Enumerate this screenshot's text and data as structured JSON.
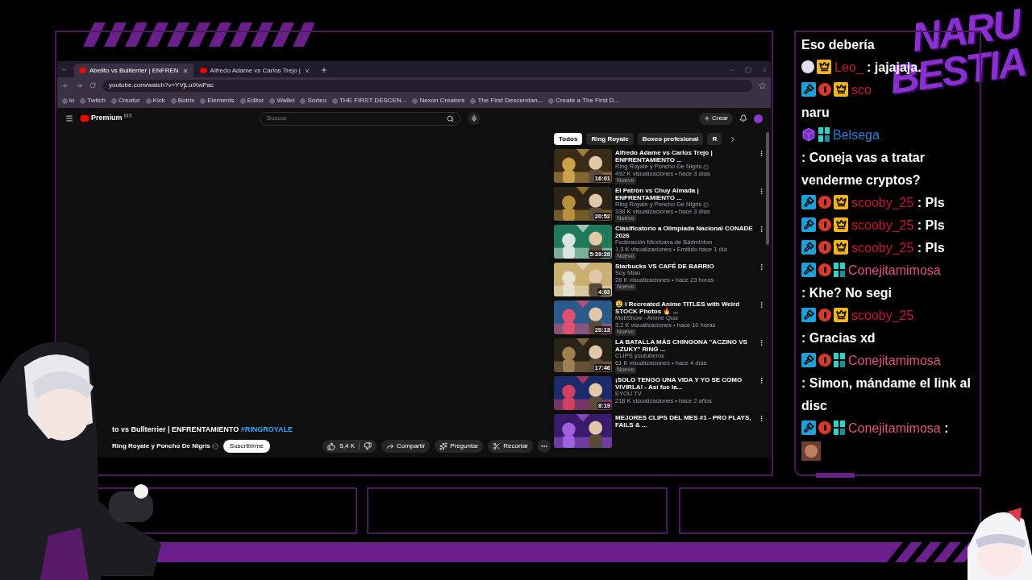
{
  "browser": {
    "tabs": [
      {
        "title": "Abelito vs Bullterrier | ENFREN",
        "selected": true
      },
      {
        "title": "Alfredo Adame vs Carlos Trejo |",
        "selected": false
      }
    ],
    "url": "youtube.com/watch?v=YVjLuiXwPac",
    "bookmarks": [
      {
        "label": "io"
      },
      {
        "label": "Twitch"
      },
      {
        "label": "Creator"
      },
      {
        "label": "Kick"
      },
      {
        "label": "Botrix"
      },
      {
        "label": "Elements"
      },
      {
        "label": "Editor"
      },
      {
        "label": "Wallet"
      },
      {
        "label": "Sorteo"
      },
      {
        "label": "THE FIRST DESCEN..."
      },
      {
        "label": "Nexon Creators"
      },
      {
        "label": "The First Descendan..."
      },
      {
        "label": "Create a The First D..."
      }
    ]
  },
  "youtube": {
    "logo": "Premium",
    "region": "MX",
    "search_placeholder": "Buscar",
    "create": "Crear",
    "video": {
      "title": "to vs Bullterrier | ENFRENTAMIENTO",
      "hashtag": "#RINGROYALE",
      "channel": "Ring Royale y Poncho De Nigris",
      "subscribe": "Suscribirme",
      "likes": "5,4 K",
      "actions": [
        {
          "kind": "share",
          "label": "Compartir"
        },
        {
          "kind": "ask",
          "label": "Preguntar"
        },
        {
          "kind": "clip",
          "label": "Recortar"
        }
      ]
    },
    "chips": [
      {
        "label": "Todos",
        "selected": true
      },
      {
        "label": "Ring Royale",
        "selected": false
      },
      {
        "label": "Boxeo profesional",
        "selected": false
      },
      {
        "label": "R",
        "selected": false
      }
    ],
    "related": [
      {
        "title": "Alfredo Adame vs Carlos Trejo | ENFRENTAMIENTO ...",
        "channel": "Ring Royale y Poncho De Nigris",
        "verified": true,
        "stats": "492 K visualizaciones • hace 3 días",
        "badge": "Nuevo",
        "duration": "16:01"
      },
      {
        "title": "El Patrón vs Chuy Almada | ENFRENTAMIENTO ...",
        "channel": "Ring Royale y Poncho De Nigris",
        "verified": true,
        "stats": "338 K visualizaciones • hace 3 días",
        "badge": "Nuevo",
        "duration": "20:52"
      },
      {
        "title": "Clasificatorio a Olimpiada Nacional CONADE 2026",
        "channel": "Federación Mexicana de Bádminton",
        "verified": false,
        "stats": "1,3 K visualizaciones • Emitido hace 1 día",
        "badge": "Nuevo",
        "duration": "5:39:28"
      },
      {
        "title": "Starbucks VS CAFÉ DE BARRIO",
        "channel": "Soy Miau",
        "verified": false,
        "stats": "28 K visualizaciones • hace 23 horas",
        "badge": "Nuevo",
        "duration": "4:02"
      },
      {
        "title": "😩 I Recreated Anime TITLES with Weird STOCK Photos 🔥 ...",
        "channel": "MobShow - Anime Quiz",
        "verified": false,
        "stats": "3,2 K visualizaciones • hace 10 horas",
        "badge": "Nuevo",
        "duration": "20:13"
      },
      {
        "title": "LA BATALLA MÁS CHINGONA \"ACZINO VS AZUKY\" RING ...",
        "channel": "CLIPS youtuberos",
        "verified": false,
        "stats": "61 K visualizaciones • hace 4 días",
        "badge": "Nuevo",
        "duration": "17:46"
      },
      {
        "title": "¡SOLO TENGO UNA VIDA Y YO SE COMO VIVIRLA! - Así fue la...",
        "channel": "EYOU TV",
        "verified": false,
        "stats": "218 K visualizaciones • hace 2 años",
        "duration": "8:19"
      },
      {
        "title": "MEJORES CLIPS DEL MES #1 - PRO PLAYS, FAILS & ..."
      }
    ]
  },
  "chat": [
    {
      "kind": "text",
      "text": "Eso debería"
    },
    {
      "kind": "message",
      "badges": [
        {
          "kind": "dot"
        },
        {
          "kind": "crown"
        }
      ],
      "name": "Leo_",
      "color": "#c8143c",
      "text": ": jajajaja."
    },
    {
      "kind": "message",
      "badges": [
        {
          "kind": "mod"
        },
        {
          "kind": "alert"
        },
        {
          "kind": "crown"
        }
      ],
      "name": "sco",
      "color": "#c8143c"
    },
    {
      "kind": "text",
      "text": "naru"
    },
    {
      "kind": "message",
      "badges": [
        {
          "kind": "cube"
        },
        {
          "kind": "bits"
        }
      ],
      "name": "Belsega",
      "color": "#2e7fd6",
      "text": ": Coneja vas a tratar venderme cryptos?"
    },
    {
      "kind": "message",
      "badges": [
        {
          "kind": "mod"
        },
        {
          "kind": "alert"
        },
        {
          "kind": "crown"
        }
      ],
      "name": "scooby_25",
      "color": "#c8143c",
      "text": ": Pls"
    },
    {
      "kind": "message",
      "badges": [
        {
          "kind": "mod"
        },
        {
          "kind": "alert"
        },
        {
          "kind": "crown"
        }
      ],
      "name": "scooby_25",
      "color": "#c8143c",
      "text": ": Pls"
    },
    {
      "kind": "message",
      "badges": [
        {
          "kind": "mod"
        },
        {
          "kind": "alert"
        },
        {
          "kind": "crown"
        }
      ],
      "name": "scooby_25",
      "color": "#c8143c",
      "text": ": Pls"
    },
    {
      "kind": "message",
      "badges": [
        {
          "kind": "mod"
        },
        {
          "kind": "alert"
        },
        {
          "kind": "bits"
        }
      ],
      "name": "Conejitamimosa",
      "color": "#e0557f",
      "text": ": Khe? No segi"
    },
    {
      "kind": "message",
      "badges": [
        {
          "kind": "mod"
        },
        {
          "kind": "alert"
        },
        {
          "kind": "crown"
        }
      ],
      "name": "scooby_25",
      "color": "#c8143c",
      "text": ": Gracias xd"
    },
    {
      "kind": "message",
      "badges": [
        {
          "kind": "mod"
        },
        {
          "kind": "alert"
        },
        {
          "kind": "bits"
        }
      ],
      "name": "Conejitamimosa",
      "color": "#e0557f",
      "text": ": Simon, mándame el link al disc"
    },
    {
      "kind": "message",
      "badges": [
        {
          "kind": "mod"
        },
        {
          "kind": "alert"
        },
        {
          "kind": "bits"
        }
      ],
      "name": "Conejitamimosa",
      "color": "#e0557f",
      "text": ":"
    },
    {
      "kind": "emote"
    }
  ],
  "logo": {
    "line_1": "NARU",
    "line_2": "BESTIA"
  }
}
